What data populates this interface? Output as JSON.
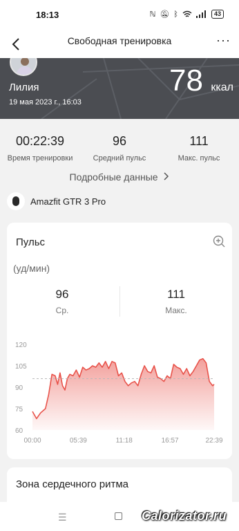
{
  "status_bar": {
    "time": "18:13",
    "icons": [
      "nfc-icon",
      "mute-icon",
      "bluetooth-icon",
      "wifi-icon",
      "signal-icon"
    ],
    "battery": "43"
  },
  "nav": {
    "title": "Свободная тренировка",
    "back_icon": "back-arrow-icon",
    "more_icon": "more-dots-icon"
  },
  "hero": {
    "name": "Лилия",
    "date": "19 мая 2023 г., 16:03",
    "kcal_value": "78",
    "kcal_unit": "ккал"
  },
  "stats": [
    {
      "value": "00:22:39",
      "label": "Время тренировки"
    },
    {
      "value": "96",
      "label": "Средний пульс"
    },
    {
      "value": "111",
      "label": "Макс. пульс"
    }
  ],
  "details_link": "Подробные данные",
  "device": {
    "name": "Amazfit GTR 3 Pro"
  },
  "pulse_card": {
    "title": "Пульс",
    "unit": "(уд/мин)",
    "avg_value": "96",
    "avg_label": "Ср.",
    "max_value": "111",
    "max_label": "Макс."
  },
  "chart_data": {
    "type": "area",
    "title": "Пульс",
    "ylabel": "(уд/мин)",
    "ylim": [
      60,
      120
    ],
    "y_ticks": [
      "120",
      "105",
      "90",
      "75",
      "60"
    ],
    "x_ticks": [
      "00:00",
      "05:39",
      "11:18",
      "16:57",
      "22:39"
    ],
    "average": 96,
    "accent_color": "#e8524a",
    "x_minutes": [
      0.0,
      0.5,
      1.0,
      1.6,
      2.0,
      2.4,
      2.8,
      3.1,
      3.4,
      3.7,
      4.0,
      4.3,
      4.6,
      5.0,
      5.4,
      5.8,
      6.2,
      6.6,
      7.0,
      7.4,
      7.8,
      8.2,
      8.6,
      9.0,
      9.4,
      9.8,
      10.2,
      10.6,
      11.0,
      11.4,
      11.8,
      12.2,
      12.6,
      13.0,
      13.4,
      13.8,
      14.2,
      14.6,
      15.0,
      15.4,
      15.8,
      16.2,
      16.6,
      17.0,
      17.4,
      17.8,
      18.2,
      18.6,
      19.0,
      19.4,
      19.8,
      20.2,
      20.6,
      21.0,
      21.4,
      21.8,
      22.2,
      22.39
    ],
    "values": [
      73,
      68,
      72,
      75,
      85,
      99,
      98,
      92,
      100,
      91,
      88,
      96,
      99,
      98,
      102,
      97,
      104,
      102,
      103,
      105,
      104,
      107,
      104,
      108,
      103,
      108,
      107,
      98,
      100,
      94,
      91,
      93,
      94,
      91,
      99,
      105,
      101,
      100,
      105,
      97,
      96,
      94,
      98,
      96,
      106,
      104,
      103,
      99,
      103,
      98,
      101,
      105,
      109,
      110,
      107,
      94,
      91,
      92
    ]
  },
  "zone_card": {
    "title": "Зона сердечного ритма"
  },
  "bottom_bar": {
    "watermark": "Calorizator.ru",
    "icons": [
      "menu-icon",
      "square-icon"
    ]
  }
}
